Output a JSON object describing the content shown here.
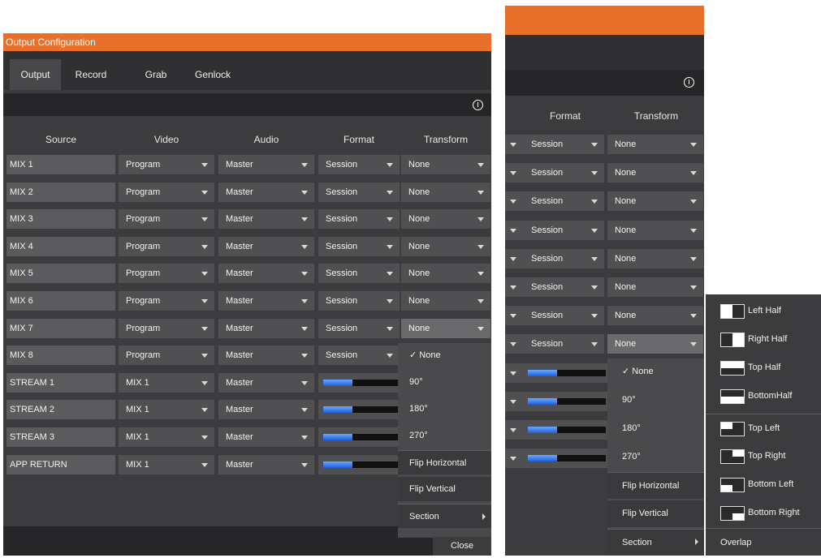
{
  "left": {
    "title": "Output Configuration",
    "tabs": [
      "Output",
      "Record",
      "Grab",
      "Genlock"
    ],
    "columns": [
      "Source",
      "Video",
      "Audio",
      "Format",
      "Transform"
    ],
    "rows": [
      {
        "source": "MIX 1",
        "video": "Program",
        "audio": "Master",
        "format": "Session",
        "transform": "None"
      },
      {
        "source": "MIX 2",
        "video": "Program",
        "audio": "Master",
        "format": "Session",
        "transform": "None"
      },
      {
        "source": "MIX 3",
        "video": "Program",
        "audio": "Master",
        "format": "Session",
        "transform": "None"
      },
      {
        "source": "MIX 4",
        "video": "Program",
        "audio": "Master",
        "format": "Session",
        "transform": "None"
      },
      {
        "source": "MIX 5",
        "video": "Program",
        "audio": "Master",
        "format": "Session",
        "transform": "None"
      },
      {
        "source": "MIX 6",
        "video": "Program",
        "audio": "Master",
        "format": "Session",
        "transform": "None"
      },
      {
        "source": "MIX 7",
        "video": "Program",
        "audio": "Master",
        "format": "Session",
        "transform": "None"
      },
      {
        "source": "MIX 8",
        "video": "Program",
        "audio": "Master",
        "format": "Session"
      },
      {
        "source": "STREAM 1",
        "video": "MIX 1",
        "audio": "Master",
        "level": 0.37
      },
      {
        "source": "STREAM 2",
        "video": "MIX 1",
        "audio": "Master",
        "level": 0.37
      },
      {
        "source": "STREAM 3",
        "video": "MIX 1",
        "audio": "Master",
        "level": 0.37
      },
      {
        "source": "APP RETURN",
        "video": "MIX 1",
        "audio": "Master",
        "level": 0.37
      }
    ],
    "transform_menu": [
      "✓ None",
      "90°",
      "180°",
      "270°",
      "Flip Horizontal",
      "Flip Vertical",
      "Section"
    ],
    "close_label": "Close"
  },
  "right": {
    "columns": [
      "Format",
      "Transform"
    ],
    "rows": [
      {
        "format": "Session",
        "transform": "None"
      },
      {
        "format": "Session",
        "transform": "None"
      },
      {
        "format": "Session",
        "transform": "None"
      },
      {
        "format": "Session",
        "transform": "None"
      },
      {
        "format": "Session",
        "transform": "None"
      },
      {
        "format": "Session",
        "transform": "None"
      },
      {
        "format": "Session",
        "transform": "None"
      },
      {
        "format": "Session",
        "transform": "None"
      },
      {
        "level": 0.37
      },
      {
        "level": 0.37
      },
      {
        "level": 0.37
      },
      {
        "level": 0.37
      }
    ],
    "transform_menu": [
      "✓ None",
      "90°",
      "180°",
      "270°",
      "Flip Horizontal",
      "Flip Vertical",
      "Section"
    ],
    "section_menu": [
      "Left Half",
      "Right Half",
      "Top Half",
      "BottomHalf",
      "Top Left",
      "Top Right",
      "Bottom Left",
      "Bottom Right",
      "Overlap"
    ]
  },
  "icons": {
    "info": "info-icon",
    "dropdown": "dropdown-arrow-icon",
    "submenu": "chevron-right-icon"
  }
}
